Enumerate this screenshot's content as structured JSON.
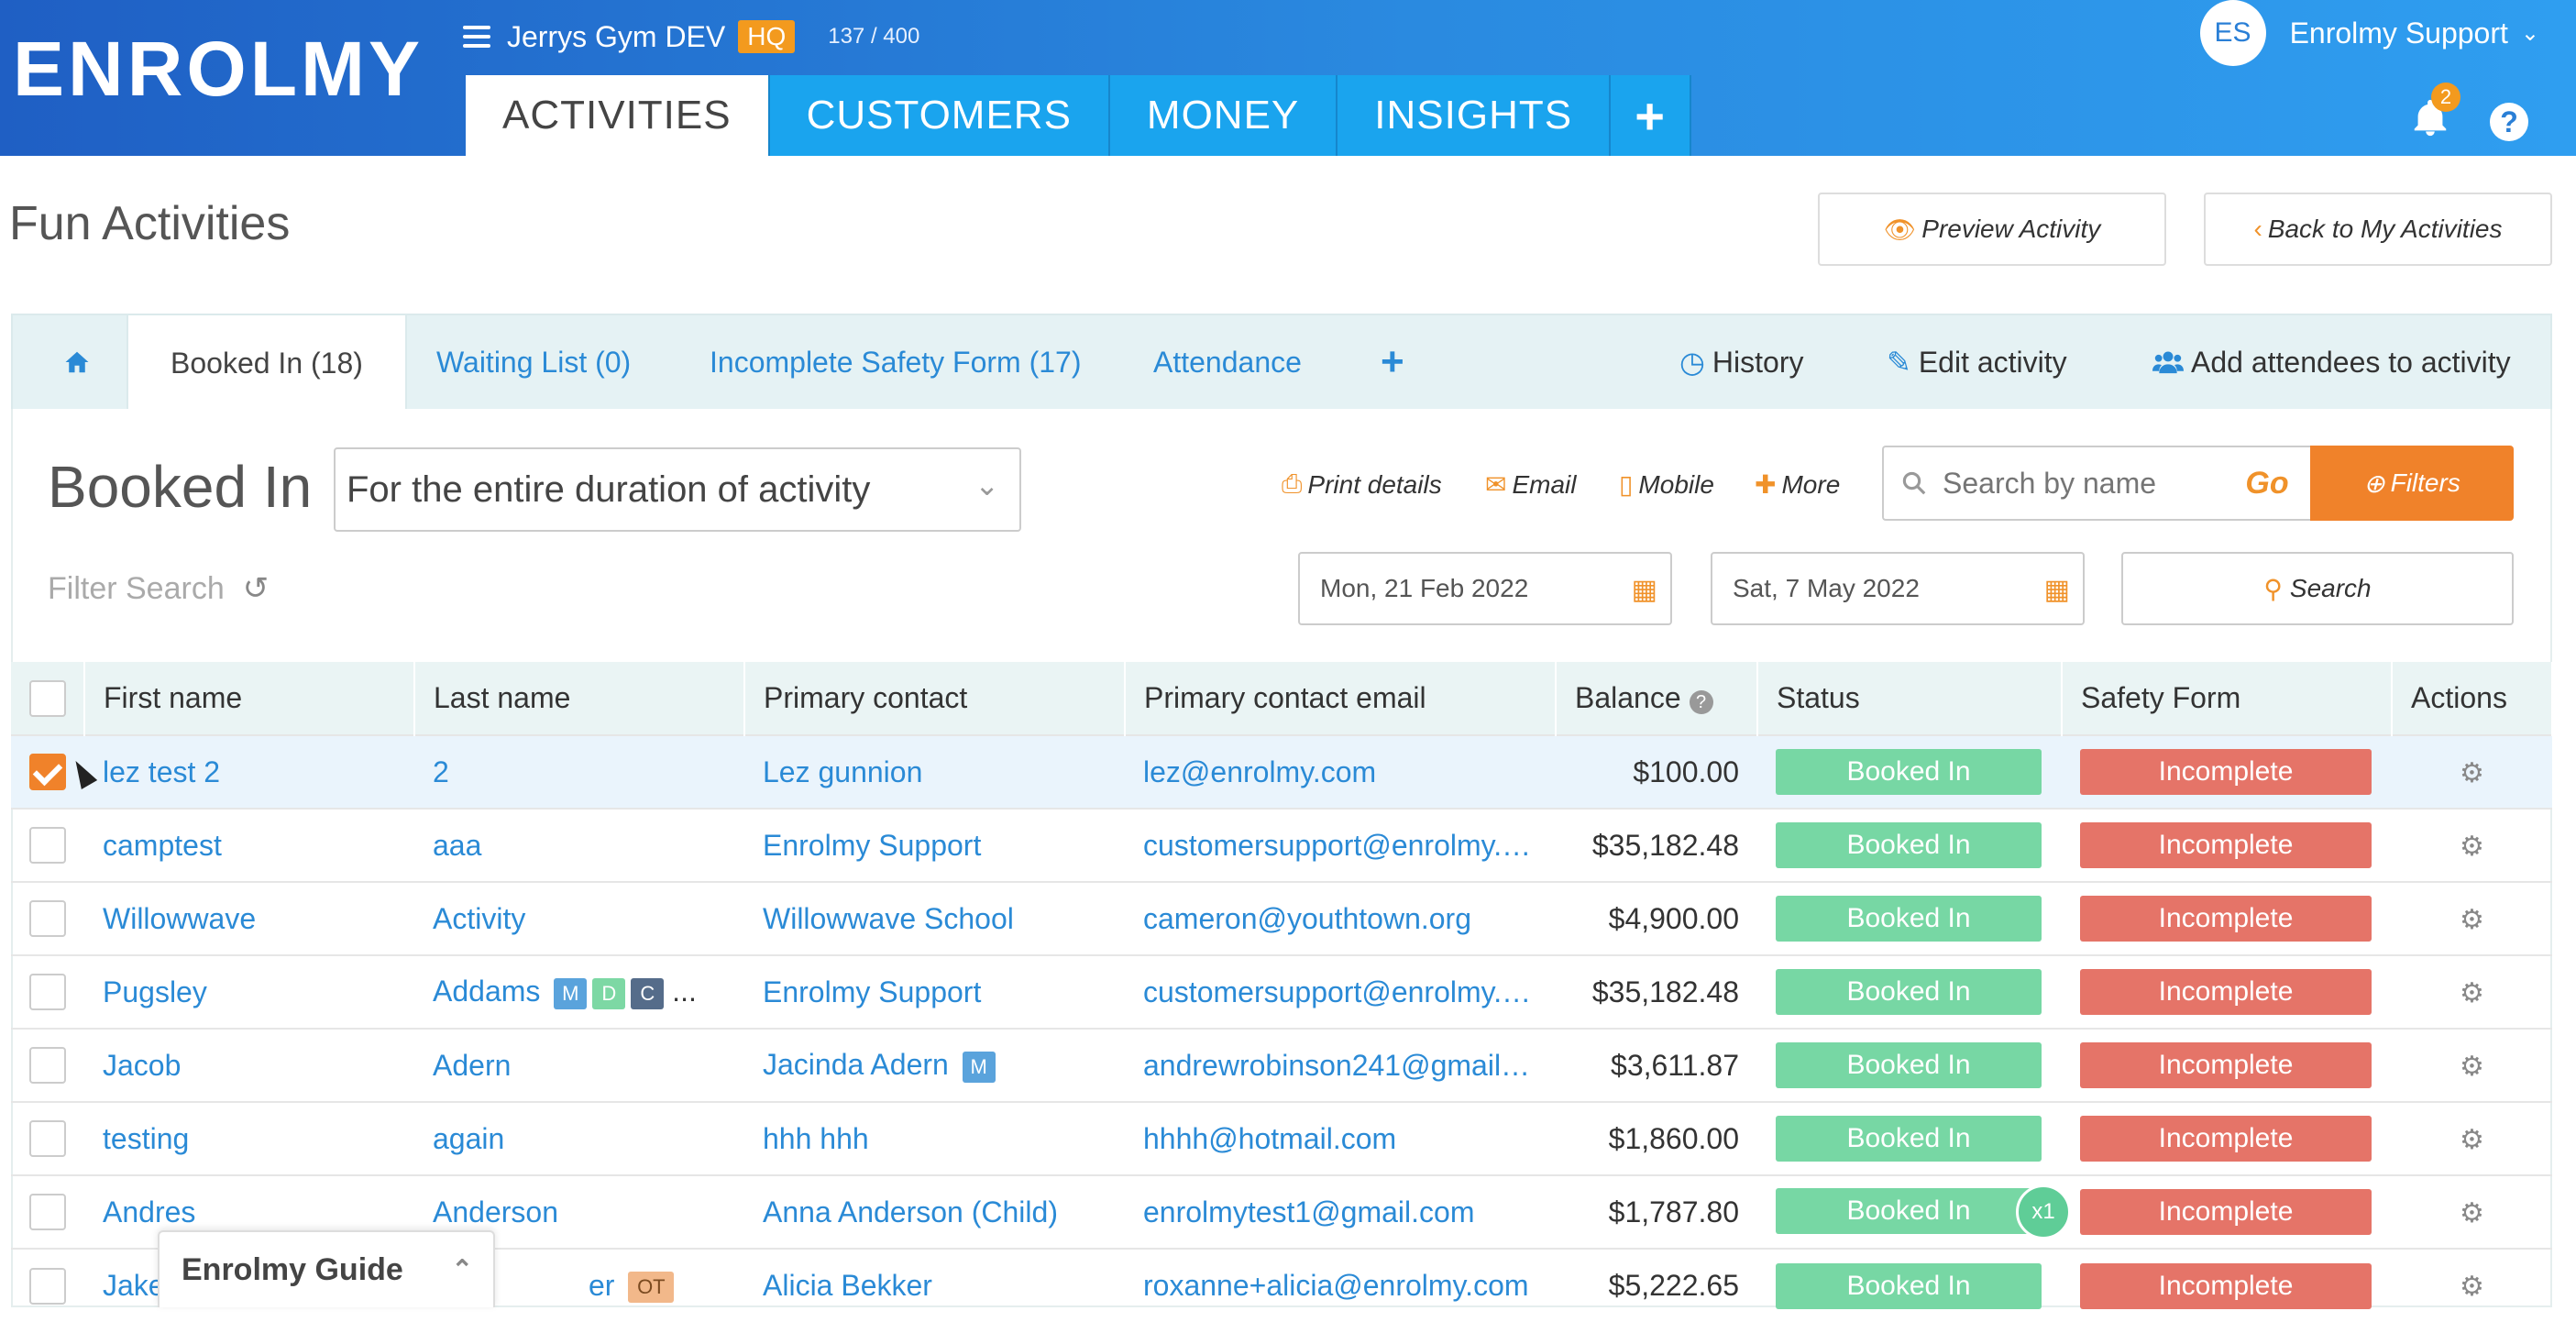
{
  "header": {
    "logo": "ENROLMY",
    "org_name": "Jerrys Gym DEV",
    "org_badge": "HQ",
    "count": "137 / 400",
    "tabs": [
      {
        "label": "ACTIVITIES",
        "active": true
      },
      {
        "label": "CUSTOMERS",
        "active": false
      },
      {
        "label": "MONEY",
        "active": false
      },
      {
        "label": "INSIGHTS",
        "active": false
      }
    ],
    "add_tab_label": "+",
    "user_initials": "ES",
    "user_name": "Enrolmy Support",
    "notifications_count": "2",
    "help_label": "?"
  },
  "page": {
    "title": "Fun Activities",
    "preview_button": "Preview Activity",
    "back_button": "Back to My Activities"
  },
  "activity_tabs": {
    "booked_in": "Booked In (18)",
    "waiting_list": "Waiting List (0)",
    "incomplete_safety": "Incomplete Safety Form (17)",
    "attendance": "Attendance",
    "add": "+",
    "history": "History",
    "edit": "Edit activity",
    "add_attendees": "Add attendees to activity"
  },
  "toolbar": {
    "section_title": "Booked In",
    "duration_value": "For the entire duration of activity",
    "print": "Print details",
    "email": "Email",
    "mobile": "Mobile",
    "more": "More",
    "search_placeholder": "Search by name",
    "go": "Go",
    "filters": "Filters",
    "filter_search": "Filter Search",
    "start_date": "Mon, 21 Feb 2022",
    "end_date": "Sat, 7 May 2022",
    "search_button": "Search"
  },
  "table": {
    "columns": [
      "First name",
      "Last name",
      "Primary contact",
      "Primary contact email",
      "Balance",
      "Status",
      "Safety Form",
      "Actions"
    ],
    "rows": [
      {
        "first": "lez test 2",
        "last": "2",
        "contact": "Lez gunnion",
        "email": "lez@enrolmy.com",
        "balance": "$100.00",
        "status": "Booked In",
        "safety": "Incomplete",
        "checked": true
      },
      {
        "first": "camptest",
        "last": "aaa",
        "contact": "Enrolmy Support",
        "email": "customersupport@enrolmy.c...",
        "balance": "$35,182.48",
        "status": "Booked In",
        "safety": "Incomplete"
      },
      {
        "first": "Willowwave",
        "last": "Activity",
        "contact": "Willowwave School",
        "email": "cameron@youthtown.org",
        "balance": "$4,900.00",
        "status": "Booked In",
        "safety": "Incomplete"
      },
      {
        "first": "Pugsley",
        "last": "Addams",
        "last_tags": [
          "M",
          "D",
          "C"
        ],
        "last_more": "...",
        "contact": "Enrolmy Support",
        "email": "customersupport@enrolmy.c...",
        "balance": "$35,182.48",
        "status": "Booked In",
        "safety": "Incomplete"
      },
      {
        "first": "Jacob",
        "last": "Adern",
        "contact": "Jacinda Adern",
        "contact_tag": "M",
        "email": "andrewrobinson241@gmail.c...",
        "balance": "$3,611.87",
        "status": "Booked In",
        "safety": "Incomplete"
      },
      {
        "first": "testing",
        "last": "again",
        "contact": "hhh hhh",
        "email": "hhhh@hotmail.com",
        "balance": "$1,860.00",
        "status": "Booked In",
        "safety": "Incomplete"
      },
      {
        "first": "Andres",
        "last": "Anderson",
        "contact": "Anna Anderson (Child)",
        "email": "enrolmytest1@gmail.com",
        "balance": "$1,787.80",
        "status": "Booked In",
        "status_badge": "x1",
        "safety": "Incomplete"
      },
      {
        "first": "Jake",
        "last": "er",
        "last_tag": "OT",
        "contact": "Alicia Bekker",
        "email": "roxanne+alicia@enrolmy.com",
        "balance": "$5,222.65",
        "status": "Booked In",
        "safety": "Incomplete"
      }
    ]
  },
  "guide": {
    "label": "Enrolmy Guide"
  },
  "colors": {
    "header_blue": "#1f5fc4",
    "tab_blue": "#1aa4ee",
    "accent_orange": "#f0822a",
    "status_green": "#77d7a4",
    "safety_red": "#e57468"
  }
}
